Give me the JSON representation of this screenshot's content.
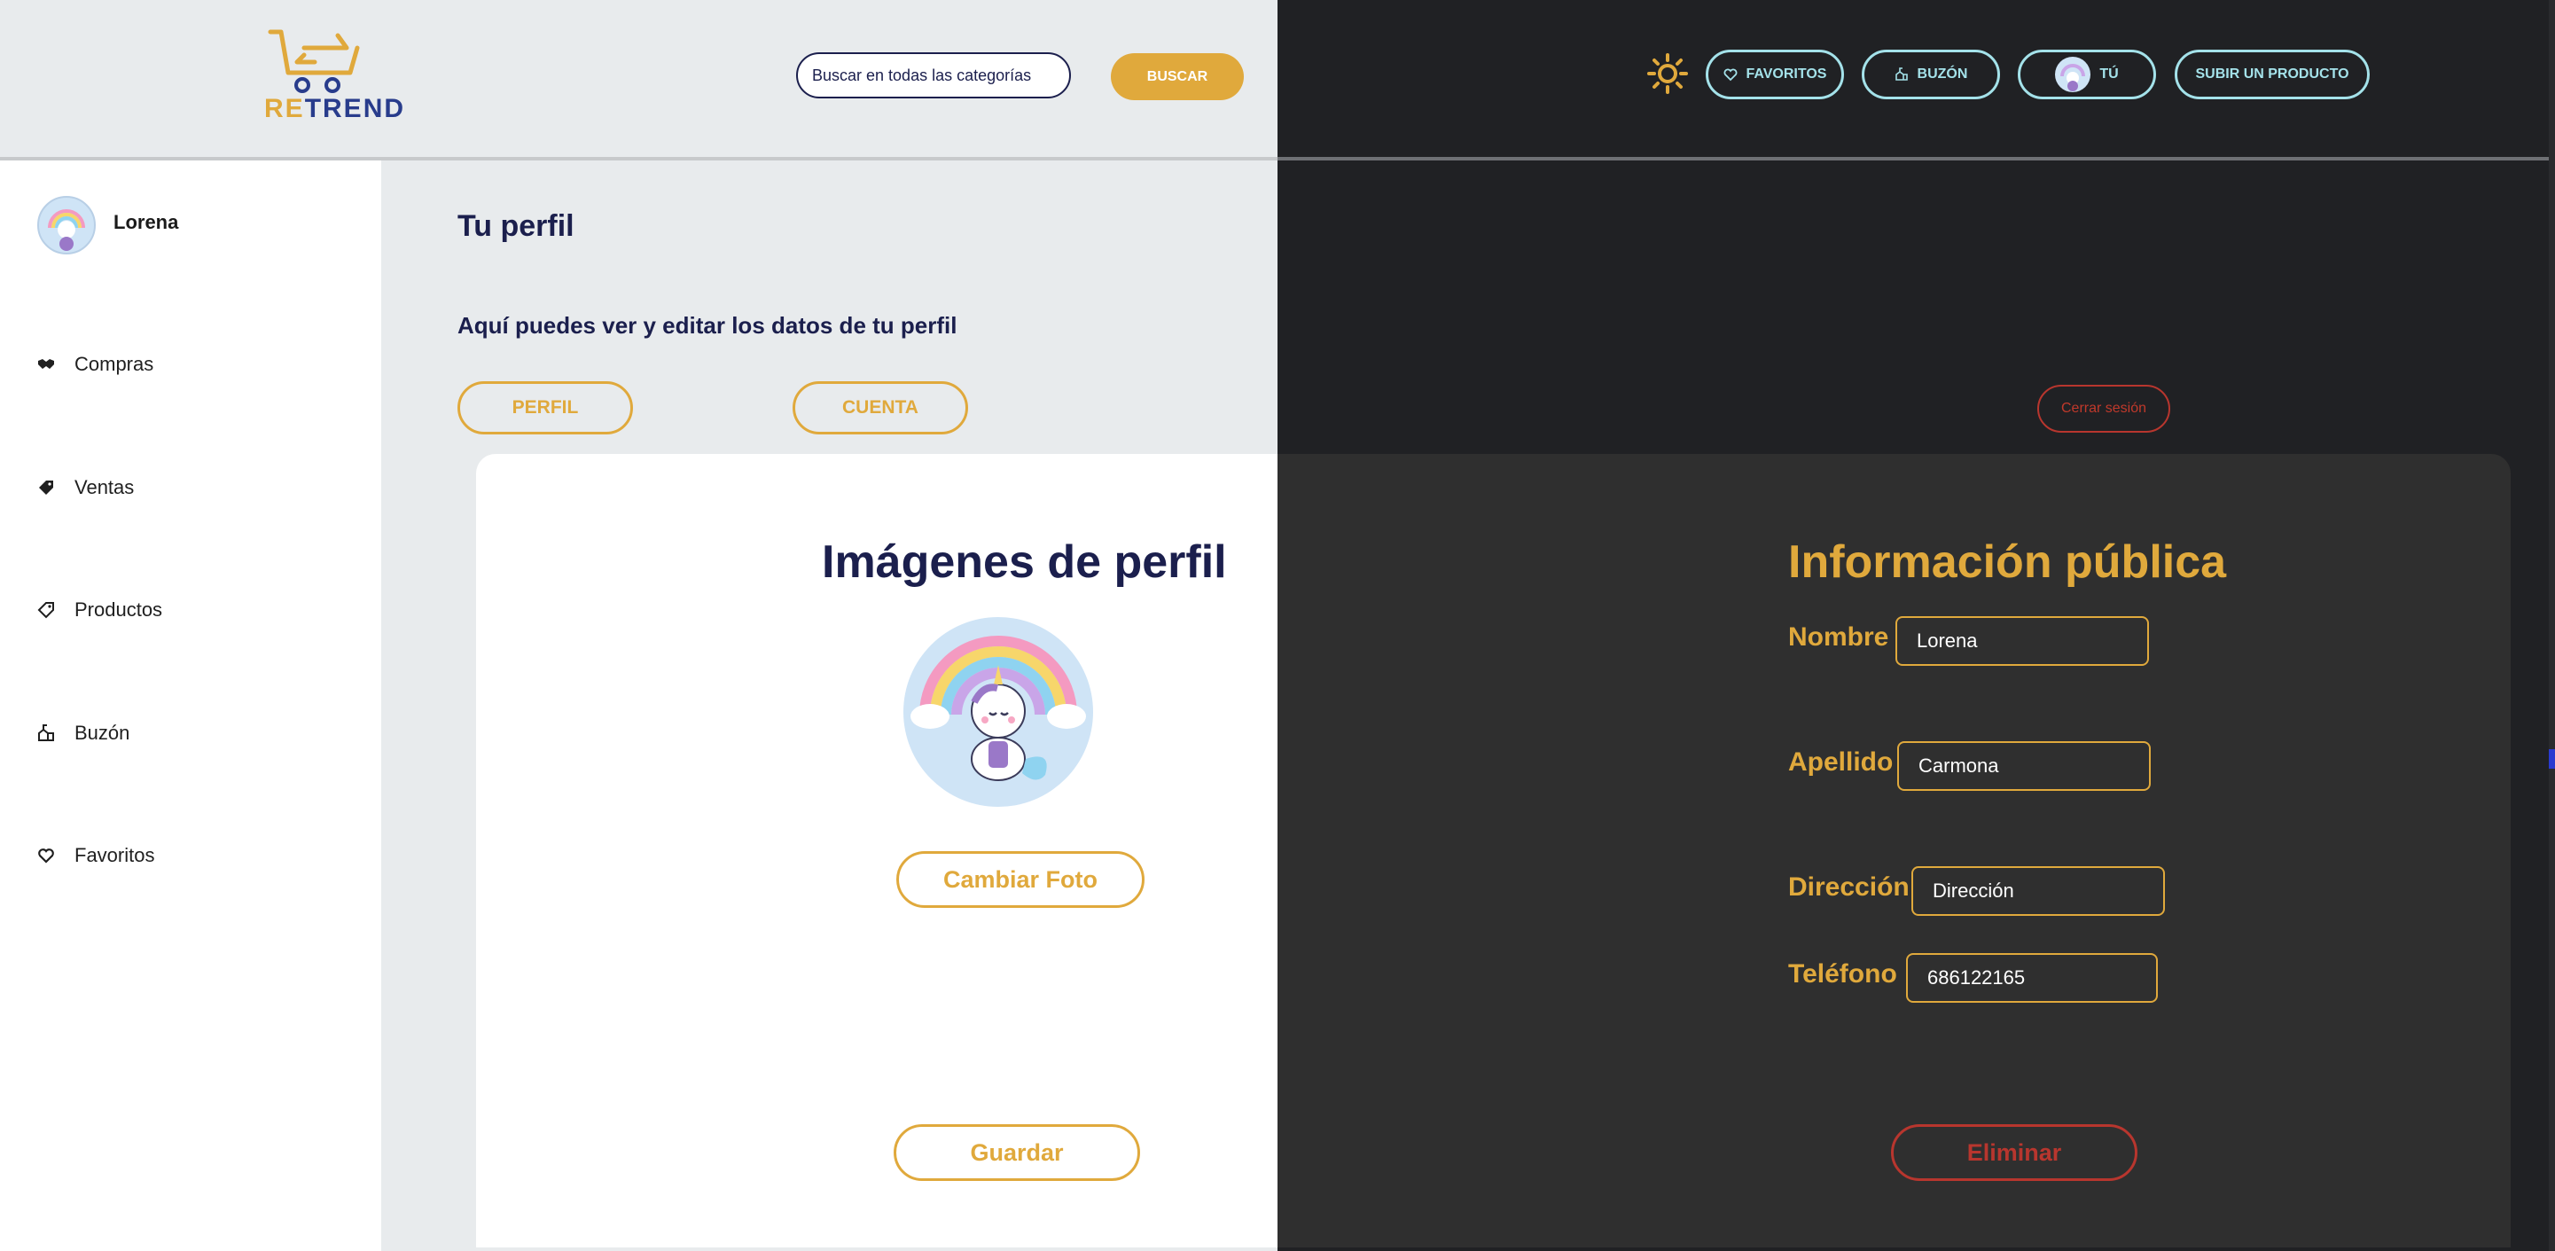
{
  "logo": {
    "part1": "RE",
    "part2": "TREND"
  },
  "search": {
    "placeholder": "Buscar en todas las categorías",
    "button_label": "BUSCAR"
  },
  "header": {
    "favorites_label": "FAVORITOS",
    "mailbox_label": "BUZÓN",
    "you_label": "TÚ",
    "upload_label": "SUBIR UN PRODUCTO"
  },
  "sidebar": {
    "user_name": "Lorena",
    "items": [
      {
        "label": "Compras",
        "icon": "handshake-icon"
      },
      {
        "label": "Ventas",
        "icon": "tag-money-icon"
      },
      {
        "label": "Productos",
        "icon": "tag-icon"
      },
      {
        "label": "Buzón",
        "icon": "mailbox-icon"
      },
      {
        "label": "Favoritos",
        "icon": "heart-icon"
      }
    ]
  },
  "main": {
    "title": "Tu perfil",
    "subtitle": "Aquí puedes ver y editar los datos de tu perfil",
    "tabs": [
      {
        "label": "PERFIL"
      },
      {
        "label": "CUENTA"
      }
    ],
    "logout_label": "Cerrar sesión"
  },
  "profile_images": {
    "title": "Imágenes de perfil",
    "change_photo_label": "Cambiar Foto",
    "save_label": "Guardar"
  },
  "public_info": {
    "title": "Información pública",
    "fields": [
      {
        "label": "Nombre",
        "value": "Lorena",
        "placeholder": ""
      },
      {
        "label": "Apellido",
        "value": "Carmona",
        "placeholder": ""
      },
      {
        "label": "Dirección",
        "value": "",
        "placeholder": "Dirección"
      },
      {
        "label": "Teléfono",
        "value": "686122165",
        "placeholder": ""
      }
    ],
    "delete_label": "Eliminar"
  },
  "colors": {
    "brand_gold": "#e0a93c",
    "brand_navy": "#1b1f4d",
    "accent_cyan": "#a4e2ea",
    "danger_red": "#b8362e"
  }
}
